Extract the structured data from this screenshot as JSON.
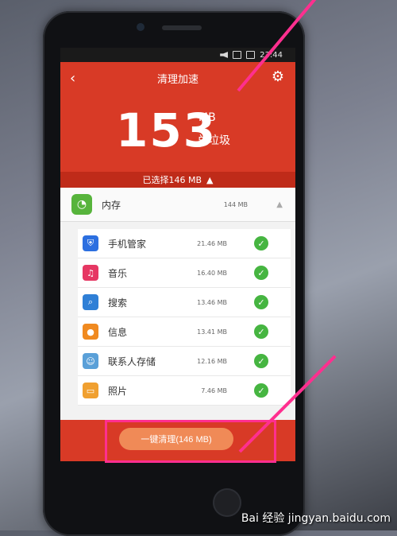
{
  "status": {
    "time": "23:44"
  },
  "header": {
    "title": "清理加速"
  },
  "summary": {
    "total_value": "153",
    "unit": "MB",
    "label": "总垃圾"
  },
  "selected": {
    "text": "已选择146 MB"
  },
  "memory": {
    "label": "内存",
    "size": "144 MB"
  },
  "items": [
    {
      "name": "手机管家",
      "size": "21.46 MB",
      "icon": "shield-icon",
      "color": "#2c6fe0"
    },
    {
      "name": "音乐",
      "size": "16.40 MB",
      "icon": "music-icon",
      "color": "#e63763"
    },
    {
      "name": "搜索",
      "size": "13.46 MB",
      "icon": "search-icon",
      "color": "#2f7fd6"
    },
    {
      "name": "信息",
      "size": "13.41 MB",
      "icon": "message-icon",
      "color": "#f08a20"
    },
    {
      "name": "联系人存储",
      "size": "12.16 MB",
      "icon": "contacts-icon",
      "color": "#5aa0d8"
    },
    {
      "name": "照片",
      "size": "7.46 MB",
      "icon": "photo-icon",
      "color": "#f0a030"
    }
  ],
  "footer": {
    "clean_label": "一键清理(146 MB)"
  },
  "watermark": {
    "text": "Bai 经验 jingyan.baidu.com"
  },
  "colors": {
    "primary_red": "#d83a26",
    "check_green": "#46b541",
    "annotation_pink": "#ff2f8f"
  }
}
